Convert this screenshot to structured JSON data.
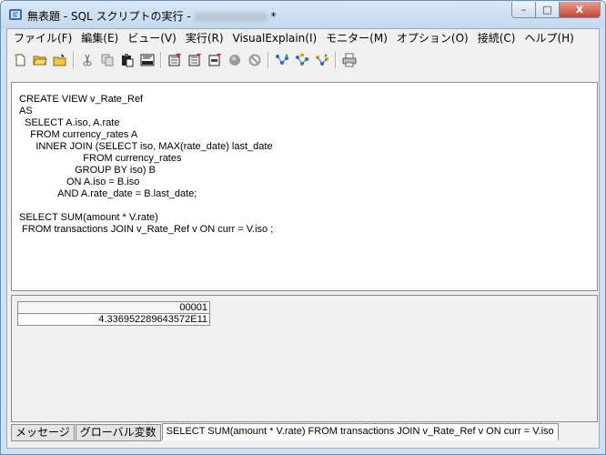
{
  "window": {
    "title_prefix": "無表題 - SQL スクリプトの実行 -",
    "title_suffix": "*",
    "minimize_label": "–",
    "maximize_label": "□",
    "close_label": "x"
  },
  "menu": [
    {
      "label": "ファイル(F)"
    },
    {
      "label": "編集(E)"
    },
    {
      "label": "ビュー(V)"
    },
    {
      "label": "実行(R)"
    },
    {
      "label": "VisualExplain(I)"
    },
    {
      "label": "モニター(M)"
    },
    {
      "label": "オプション(O)"
    },
    {
      "label": "接続(C)"
    },
    {
      "label": "ヘルプ(H)"
    }
  ],
  "toolbar": [
    {
      "icon": "new-file-icon"
    },
    {
      "icon": "open-folder-icon"
    },
    {
      "icon": "save-icon"
    },
    {
      "icon": "cut-icon"
    },
    {
      "icon": "copy-icon"
    },
    {
      "icon": "paste-icon"
    },
    {
      "icon": "sql-icon"
    },
    {
      "icon": "run-icon"
    },
    {
      "icon": "run-step-icon"
    },
    {
      "icon": "run-selection-icon"
    },
    {
      "icon": "stop-icon"
    },
    {
      "icon": "cancel-icon"
    },
    {
      "icon": "explain-icon"
    },
    {
      "icon": "explain-step-icon"
    },
    {
      "icon": "explain-selection-icon"
    },
    {
      "icon": "print-icon"
    }
  ],
  "editor": {
    "sql": "CREATE VIEW v_Rate_Ref\nAS\n  SELECT A.iso, A.rate\n    FROM currency_rates A\n      INNER JOIN (SELECT iso, MAX(rate_date) last_date\n                       FROM currency_rates\n                    GROUP BY iso) B\n                 ON A.iso = B.iso\n              AND A.rate_date = B.last_date;\n\nSELECT SUM(amount * V.rate)\n FROM transactions JOIN v_Rate_Ref v ON curr = V.iso ;"
  },
  "results": {
    "columns": [
      "00001"
    ],
    "rows": [
      [
        "4.336952289643572E11"
      ]
    ]
  },
  "tabs": [
    {
      "label": "メッセージ"
    },
    {
      "label": "グローバル変数"
    },
    {
      "label": "SELECT SUM(amount * V.rate)   FROM transactions JOIN v_Rate_Ref v ON curr = V.iso"
    }
  ]
}
